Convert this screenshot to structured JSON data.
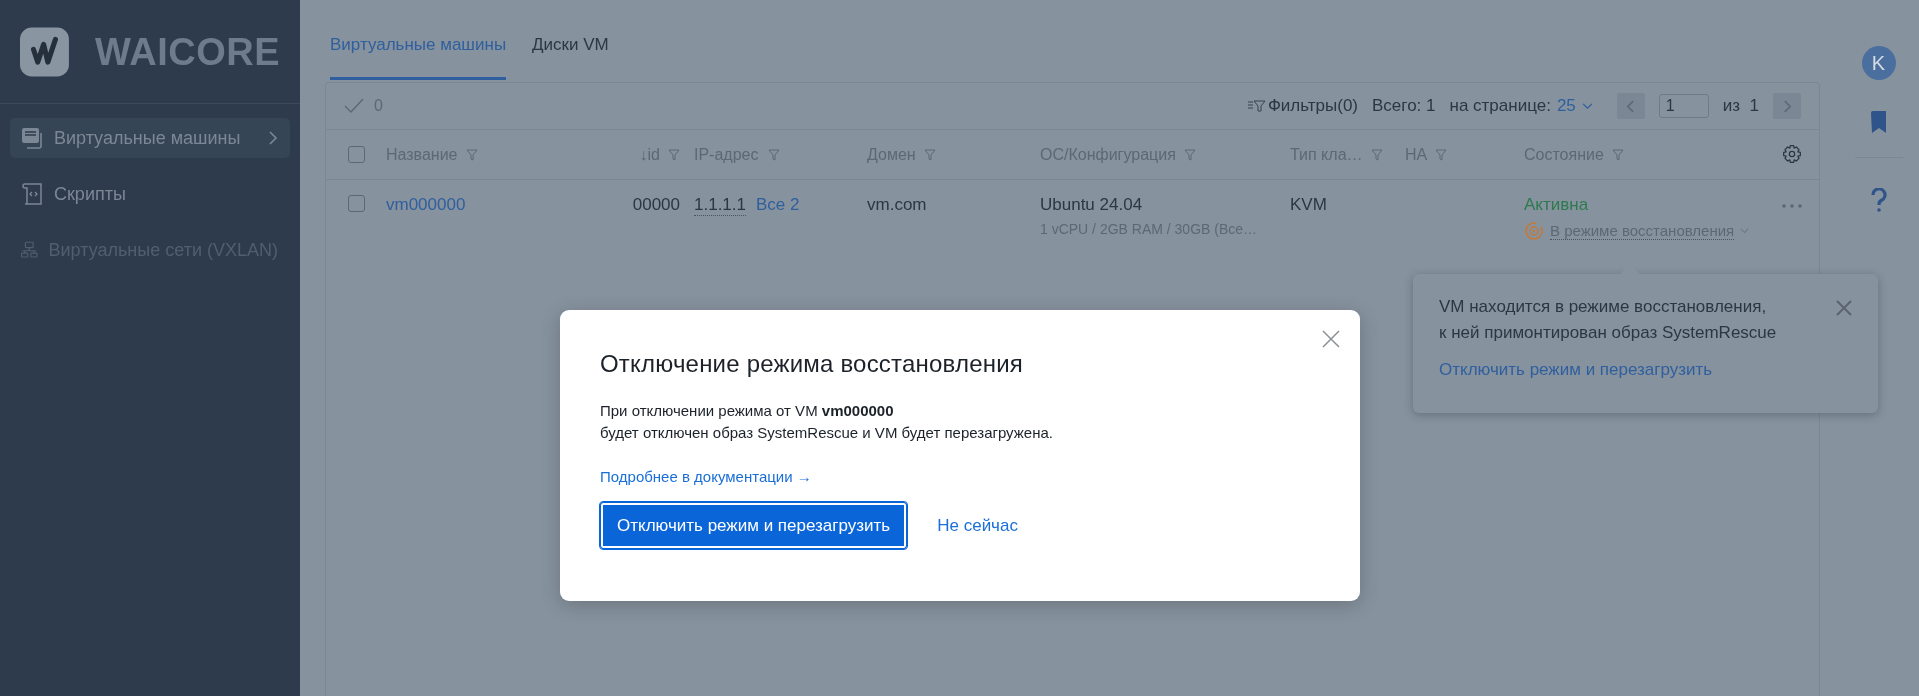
{
  "sidebar": {
    "logo_text": "WAICORE",
    "items": [
      {
        "label": "Виртуальные машины",
        "kind": "vm",
        "selected": true,
        "disabled": false
      },
      {
        "label": "Скрипты",
        "kind": "script",
        "selected": false,
        "disabled": false
      },
      {
        "label": "Виртуальные сети (VXLAN)",
        "kind": "network",
        "selected": false,
        "disabled": true
      }
    ]
  },
  "tabs": [
    {
      "label": "Виртуальные машины",
      "selected": true
    },
    {
      "label": "Диски VM",
      "selected": false
    }
  ],
  "toolbar": {
    "selected_count": "0",
    "filters": "Фильтры(0)",
    "total": "Всего: 1",
    "per_page_label": "на странице:",
    "per_page": "25",
    "page": "1",
    "of": "из",
    "pages": "1"
  },
  "table": {
    "header_checked": false,
    "columns": [
      "Название",
      "↓id",
      "IP-адрес",
      "Домен",
      "ОС/Конфигурация",
      "Тип кла…",
      "HA",
      "Состояние"
    ],
    "rows": [
      {
        "checked": false,
        "name": "vm000000",
        "id": "00000",
        "ip": "1.1.1.1",
        "ip_more": "Все 2",
        "domain": "vm.com",
        "os": "Ubuntu 24.04",
        "config": "1 vCPU / 2GB RAM / 30GB (Все…",
        "type": "KVM",
        "status": "Активна",
        "mode": "В режиме восстановления"
      }
    ]
  },
  "right_rail": {
    "avatar": "K"
  },
  "popover": {
    "lines": [
      "VM находится в режиме восстановления,",
      "к ней примонтирован образ SystemRescue"
    ],
    "link": "Отключить режим и перезагрузить"
  },
  "modal": {
    "title": "Отключение режима восстановления",
    "body": [
      "При отключении режима от VM **vm000000**",
      "будет отключен образ SystemRescue и VM будет перезагружена."
    ],
    "doc_link": "Подробнее в документации →",
    "primary_button": "Отключить режим и перезагрузить",
    "secondary_button": "Не сейчас"
  }
}
